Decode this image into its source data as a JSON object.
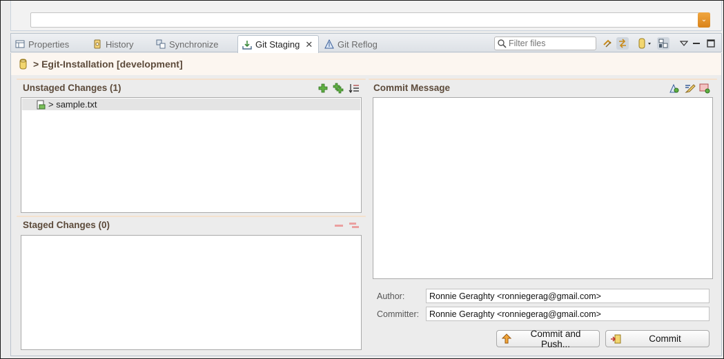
{
  "tabs": [
    {
      "label": "Properties",
      "icon": "properties-icon"
    },
    {
      "label": "History",
      "icon": "history-icon"
    },
    {
      "label": "Synchronize",
      "icon": "synchronize-icon"
    },
    {
      "label": "Git Staging",
      "icon": "git-staging-icon",
      "active": true
    },
    {
      "label": "Git Reflog",
      "icon": "git-reflog-icon"
    }
  ],
  "filter": {
    "placeholder": "Filter files"
  },
  "repo": {
    "title": "> Egit-Installation [development]"
  },
  "unstaged": {
    "title": "Unstaged Changes (1)",
    "files": [
      {
        "name": "> sample.txt"
      }
    ]
  },
  "staged": {
    "title": "Staged Changes (0)"
  },
  "commit": {
    "title": "Commit Message",
    "author_label": "Author:",
    "author_value": "Ronnie Geraghty <ronniegerag@gmail.com>",
    "committer_label": "Committer:",
    "committer_value": "Ronnie Geraghty <ronniegerag@gmail.com>",
    "commit_push_label": "Commit and Push...",
    "commit_label": "Commit"
  },
  "colors": {
    "accent": "#d9831a",
    "section_title": "#5c4a3a",
    "add_icon": "#4aa02c",
    "remove_icon": "#e58080"
  }
}
